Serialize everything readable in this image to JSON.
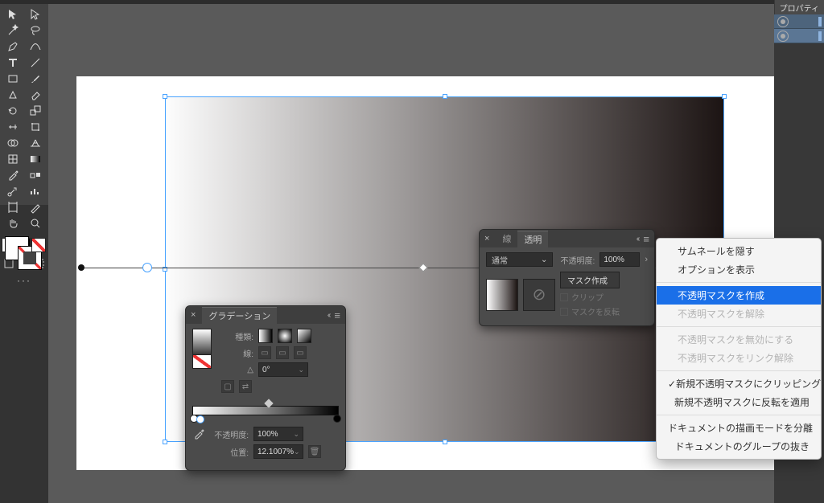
{
  "right_dock": {
    "properties_tab": "プロパティ"
  },
  "gradient_panel": {
    "title": "グラデーション",
    "type_label": "種類:",
    "stroke_label": "線:",
    "angle_value": "0°",
    "opacity_label": "不透明度:",
    "opacity_value": "100%",
    "location_label": "位置:",
    "location_value": "12.1007%"
  },
  "transparency_panel": {
    "tab_stroke": "線",
    "tab_transparency": "透明",
    "blend_mode": "通常",
    "opacity_label": "不透明度:",
    "opacity_value": "100%",
    "make_mask": "マスク作成",
    "clip": "クリップ",
    "invert": "マスクを反転"
  },
  "context_menu": {
    "hide_thumbnails": "サムネールを隠す",
    "show_options": "オプションを表示",
    "make_opacity_mask": "不透明マスクを作成",
    "release_opacity_mask": "不透明マスクを解除",
    "disable_opacity_mask": "不透明マスクを無効にする",
    "unlink_opacity_mask": "不透明マスクをリンク解除",
    "new_mask_clip": "新規不透明マスクにクリッピングを適用",
    "new_mask_invert": "新規不透明マスクに反転を適用",
    "isolate_blending": "ドキュメントの描画モードを分離",
    "knockout_group": "ドキュメントのグループの抜き"
  },
  "icons": {
    "checkmark": "✓",
    "chevron": "⌄",
    "angle": "△",
    "flip": "⇄",
    "no": "⊘",
    "more": "···",
    "close": "×",
    "collapse": "‹‹",
    "menu": "≡",
    "rchev": "›"
  }
}
